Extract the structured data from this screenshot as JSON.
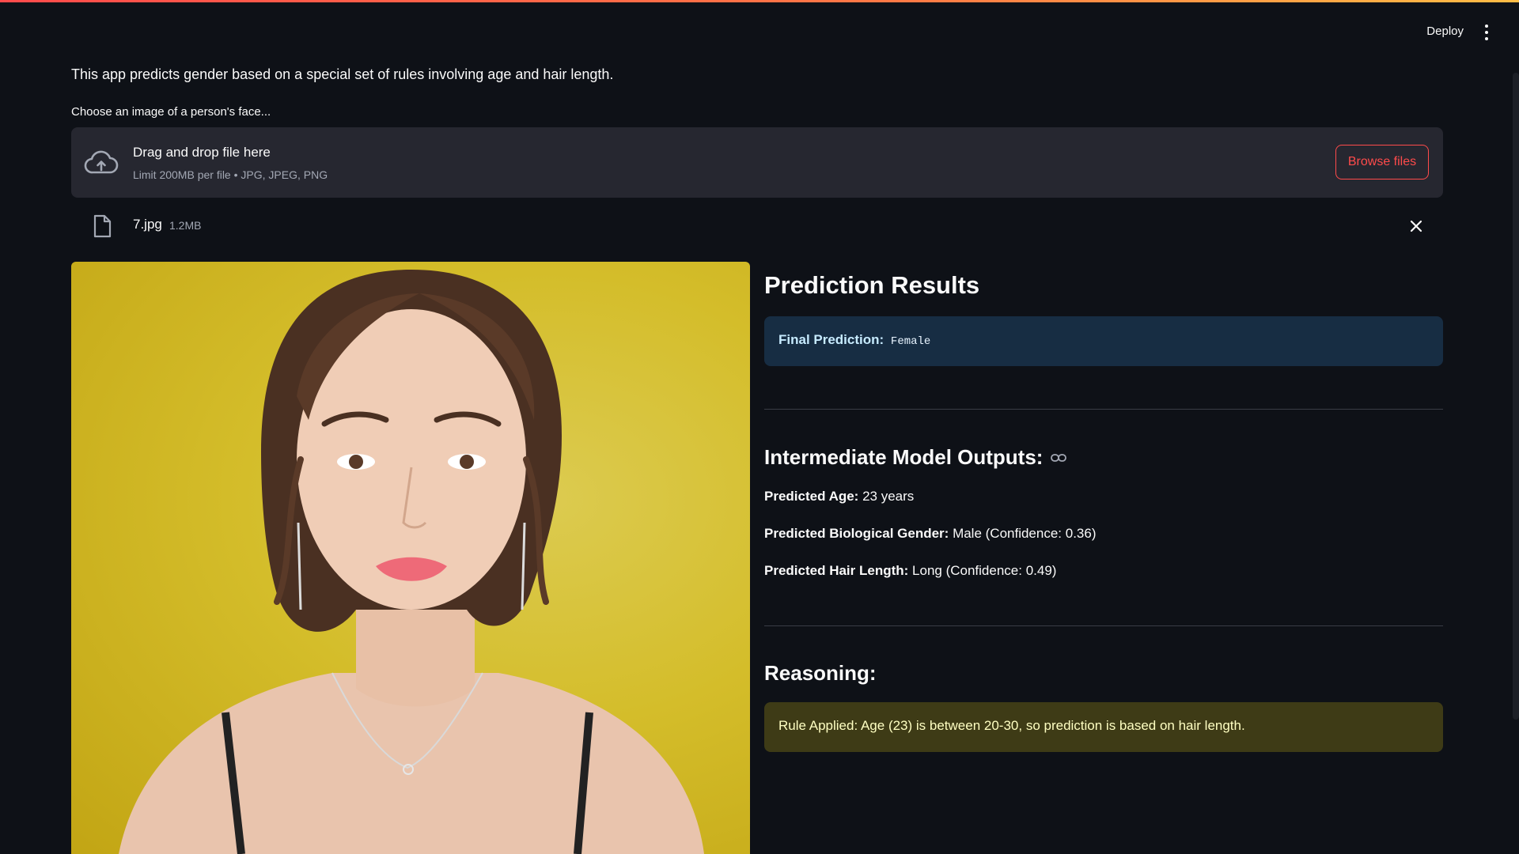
{
  "header": {
    "deploy_label": "Deploy"
  },
  "main": {
    "intro": "This app predicts gender based on a special set of rules involving age and hair length.",
    "uploader": {
      "label": "Choose an image of a person's face...",
      "drop_title": "Drag and drop file here",
      "drop_limit": "Limit 200MB per file • JPG, JPEG, PNG",
      "browse_label": "Browse files"
    },
    "file": {
      "name": "7.jpg",
      "size": "1.2MB"
    }
  },
  "results": {
    "title": "Prediction Results",
    "final_label": "Final Prediction:",
    "final_value": "Female",
    "intermediate_title": "Intermediate Model Outputs:",
    "age_label": "Predicted Age:",
    "age_value": "23 years",
    "gender_label": "Predicted Biological Gender:",
    "gender_value": "Male (Confidence: 0.36)",
    "hair_label": "Predicted Hair Length:",
    "hair_value": "Long (Confidence: 0.49)",
    "reasoning_title": "Reasoning:",
    "reasoning_text": "Rule Applied: Age (23) is between 20-30, so prediction is based on hair length."
  },
  "colors": {
    "background": "#0e1117",
    "accent": "#ff4b4b",
    "info_bg": "#172d43",
    "warning_bg": "#3e3b16"
  }
}
